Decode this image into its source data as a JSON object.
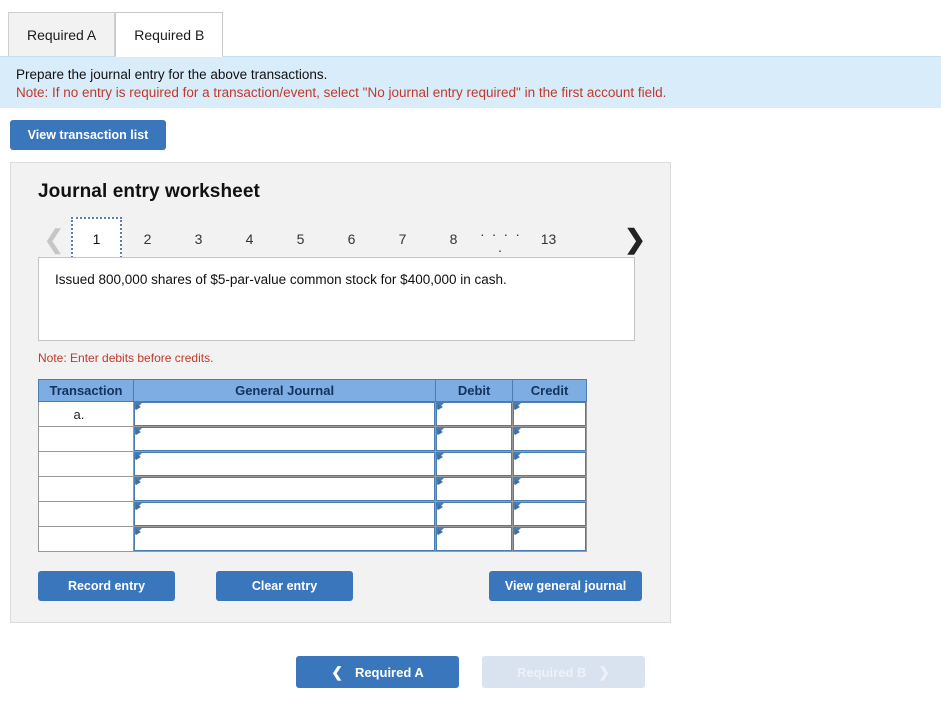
{
  "tabs": [
    {
      "label": "Required A",
      "active": false
    },
    {
      "label": "Required B",
      "active": true
    }
  ],
  "banner": {
    "instruction": "Prepare the journal entry for the above transactions.",
    "note": "Note: If no entry is required for a transaction/event, select \"No journal entry required\" in the first account field."
  },
  "toolbar": {
    "view_transaction_list": "View transaction list"
  },
  "worksheet": {
    "title": "Journal entry worksheet",
    "pager": {
      "prev_icon": "chevron-left-icon",
      "next_icon": "chevron-right-icon",
      "pages": [
        "1",
        "2",
        "3",
        "4",
        "5",
        "6",
        "7",
        "8"
      ],
      "ellipsis": ". . . . .",
      "last_page": "13",
      "active_page": "1"
    },
    "transaction_text": "Issued 800,000 shares of $5-par-value common stock for $400,000 in cash.",
    "debit_note": "Note: Enter debits before credits.",
    "table": {
      "headers": [
        "Transaction",
        "General Journal",
        "Debit",
        "Credit"
      ],
      "rows": [
        {
          "transaction": "a.",
          "general_journal": "",
          "debit": "",
          "credit": ""
        },
        {
          "transaction": "",
          "general_journal": "",
          "debit": "",
          "credit": ""
        },
        {
          "transaction": "",
          "general_journal": "",
          "debit": "",
          "credit": ""
        },
        {
          "transaction": "",
          "general_journal": "",
          "debit": "",
          "credit": ""
        },
        {
          "transaction": "",
          "general_journal": "",
          "debit": "",
          "credit": ""
        },
        {
          "transaction": "",
          "general_journal": "",
          "debit": "",
          "credit": ""
        }
      ]
    },
    "buttons": {
      "record_entry": "Record entry",
      "clear_entry": "Clear entry",
      "view_general_journal": "View general journal"
    }
  },
  "footer": {
    "prev": {
      "label": "Required A",
      "icon": "chevron-left-icon",
      "enabled": true
    },
    "next": {
      "label": "Required B",
      "icon": "chevron-right-icon",
      "enabled": false
    }
  },
  "colors": {
    "primary_blue": "#3a76bc",
    "header_blue": "#7dade2",
    "banner_blue": "#d9ecfa",
    "note_red": "#c0392b",
    "disabled_blue": "#d9e2ef"
  }
}
